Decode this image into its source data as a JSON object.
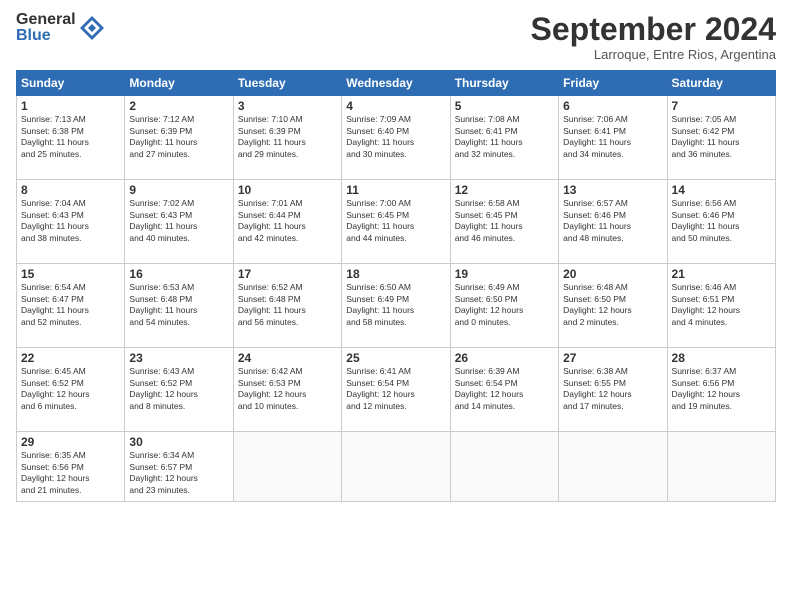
{
  "header": {
    "logo_line1": "General",
    "logo_line2": "Blue",
    "month_title": "September 2024",
    "subtitle": "Larroque, Entre Rios, Argentina"
  },
  "days_of_week": [
    "Sunday",
    "Monday",
    "Tuesday",
    "Wednesday",
    "Thursday",
    "Friday",
    "Saturday"
  ],
  "weeks": [
    [
      {
        "num": "1",
        "lines": [
          "Sunrise: 7:13 AM",
          "Sunset: 6:38 PM",
          "Daylight: 11 hours",
          "and 25 minutes."
        ]
      },
      {
        "num": "2",
        "lines": [
          "Sunrise: 7:12 AM",
          "Sunset: 6:39 PM",
          "Daylight: 11 hours",
          "and 27 minutes."
        ]
      },
      {
        "num": "3",
        "lines": [
          "Sunrise: 7:10 AM",
          "Sunset: 6:39 PM",
          "Daylight: 11 hours",
          "and 29 minutes."
        ]
      },
      {
        "num": "4",
        "lines": [
          "Sunrise: 7:09 AM",
          "Sunset: 6:40 PM",
          "Daylight: 11 hours",
          "and 30 minutes."
        ]
      },
      {
        "num": "5",
        "lines": [
          "Sunrise: 7:08 AM",
          "Sunset: 6:41 PM",
          "Daylight: 11 hours",
          "and 32 minutes."
        ]
      },
      {
        "num": "6",
        "lines": [
          "Sunrise: 7:06 AM",
          "Sunset: 6:41 PM",
          "Daylight: 11 hours",
          "and 34 minutes."
        ]
      },
      {
        "num": "7",
        "lines": [
          "Sunrise: 7:05 AM",
          "Sunset: 6:42 PM",
          "Daylight: 11 hours",
          "and 36 minutes."
        ]
      }
    ],
    [
      {
        "num": "8",
        "lines": [
          "Sunrise: 7:04 AM",
          "Sunset: 6:43 PM",
          "Daylight: 11 hours",
          "and 38 minutes."
        ]
      },
      {
        "num": "9",
        "lines": [
          "Sunrise: 7:02 AM",
          "Sunset: 6:43 PM",
          "Daylight: 11 hours",
          "and 40 minutes."
        ]
      },
      {
        "num": "10",
        "lines": [
          "Sunrise: 7:01 AM",
          "Sunset: 6:44 PM",
          "Daylight: 11 hours",
          "and 42 minutes."
        ]
      },
      {
        "num": "11",
        "lines": [
          "Sunrise: 7:00 AM",
          "Sunset: 6:45 PM",
          "Daylight: 11 hours",
          "and 44 minutes."
        ]
      },
      {
        "num": "12",
        "lines": [
          "Sunrise: 6:58 AM",
          "Sunset: 6:45 PM",
          "Daylight: 11 hours",
          "and 46 minutes."
        ]
      },
      {
        "num": "13",
        "lines": [
          "Sunrise: 6:57 AM",
          "Sunset: 6:46 PM",
          "Daylight: 11 hours",
          "and 48 minutes."
        ]
      },
      {
        "num": "14",
        "lines": [
          "Sunrise: 6:56 AM",
          "Sunset: 6:46 PM",
          "Daylight: 11 hours",
          "and 50 minutes."
        ]
      }
    ],
    [
      {
        "num": "15",
        "lines": [
          "Sunrise: 6:54 AM",
          "Sunset: 6:47 PM",
          "Daylight: 11 hours",
          "and 52 minutes."
        ]
      },
      {
        "num": "16",
        "lines": [
          "Sunrise: 6:53 AM",
          "Sunset: 6:48 PM",
          "Daylight: 11 hours",
          "and 54 minutes."
        ]
      },
      {
        "num": "17",
        "lines": [
          "Sunrise: 6:52 AM",
          "Sunset: 6:48 PM",
          "Daylight: 11 hours",
          "and 56 minutes."
        ]
      },
      {
        "num": "18",
        "lines": [
          "Sunrise: 6:50 AM",
          "Sunset: 6:49 PM",
          "Daylight: 11 hours",
          "and 58 minutes."
        ]
      },
      {
        "num": "19",
        "lines": [
          "Sunrise: 6:49 AM",
          "Sunset: 6:50 PM",
          "Daylight: 12 hours",
          "and 0 minutes."
        ]
      },
      {
        "num": "20",
        "lines": [
          "Sunrise: 6:48 AM",
          "Sunset: 6:50 PM",
          "Daylight: 12 hours",
          "and 2 minutes."
        ]
      },
      {
        "num": "21",
        "lines": [
          "Sunrise: 6:46 AM",
          "Sunset: 6:51 PM",
          "Daylight: 12 hours",
          "and 4 minutes."
        ]
      }
    ],
    [
      {
        "num": "22",
        "lines": [
          "Sunrise: 6:45 AM",
          "Sunset: 6:52 PM",
          "Daylight: 12 hours",
          "and 6 minutes."
        ]
      },
      {
        "num": "23",
        "lines": [
          "Sunrise: 6:43 AM",
          "Sunset: 6:52 PM",
          "Daylight: 12 hours",
          "and 8 minutes."
        ]
      },
      {
        "num": "24",
        "lines": [
          "Sunrise: 6:42 AM",
          "Sunset: 6:53 PM",
          "Daylight: 12 hours",
          "and 10 minutes."
        ]
      },
      {
        "num": "25",
        "lines": [
          "Sunrise: 6:41 AM",
          "Sunset: 6:54 PM",
          "Daylight: 12 hours",
          "and 12 minutes."
        ]
      },
      {
        "num": "26",
        "lines": [
          "Sunrise: 6:39 AM",
          "Sunset: 6:54 PM",
          "Daylight: 12 hours",
          "and 14 minutes."
        ]
      },
      {
        "num": "27",
        "lines": [
          "Sunrise: 6:38 AM",
          "Sunset: 6:55 PM",
          "Daylight: 12 hours",
          "and 17 minutes."
        ]
      },
      {
        "num": "28",
        "lines": [
          "Sunrise: 6:37 AM",
          "Sunset: 6:56 PM",
          "Daylight: 12 hours",
          "and 19 minutes."
        ]
      }
    ],
    [
      {
        "num": "29",
        "lines": [
          "Sunrise: 6:35 AM",
          "Sunset: 6:56 PM",
          "Daylight: 12 hours",
          "and 21 minutes."
        ]
      },
      {
        "num": "30",
        "lines": [
          "Sunrise: 6:34 AM",
          "Sunset: 6:57 PM",
          "Daylight: 12 hours",
          "and 23 minutes."
        ]
      },
      {
        "num": "",
        "lines": []
      },
      {
        "num": "",
        "lines": []
      },
      {
        "num": "",
        "lines": []
      },
      {
        "num": "",
        "lines": []
      },
      {
        "num": "",
        "lines": []
      }
    ]
  ]
}
